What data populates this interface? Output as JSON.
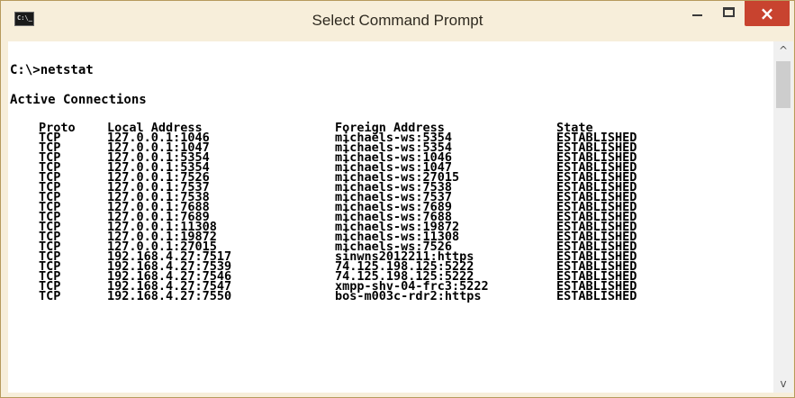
{
  "window": {
    "title": "Select Command Prompt",
    "icon_label": "C:\\_",
    "close_label": "×"
  },
  "console": {
    "prompt_line": "C:\\>netstat",
    "heading": "Active Connections",
    "columns": [
      "Proto",
      "Local Address",
      "Foreign Address",
      "State"
    ],
    "rows": [
      [
        "TCP",
        "127.0.0.1:1046",
        "michaels-ws:5354",
        "ESTABLISHED"
      ],
      [
        "TCP",
        "127.0.0.1:1047",
        "michaels-ws:5354",
        "ESTABLISHED"
      ],
      [
        "TCP",
        "127.0.0.1:5354",
        "michaels-ws:1046",
        "ESTABLISHED"
      ],
      [
        "TCP",
        "127.0.0.1:5354",
        "michaels-ws:1047",
        "ESTABLISHED"
      ],
      [
        "TCP",
        "127.0.0.1:7526",
        "michaels-ws:27015",
        "ESTABLISHED"
      ],
      [
        "TCP",
        "127.0.0.1:7537",
        "michaels-ws:7538",
        "ESTABLISHED"
      ],
      [
        "TCP",
        "127.0.0.1:7538",
        "michaels-ws:7537",
        "ESTABLISHED"
      ],
      [
        "TCP",
        "127.0.0.1:7688",
        "michaels-ws:7689",
        "ESTABLISHED"
      ],
      [
        "TCP",
        "127.0.0.1:7689",
        "michaels-ws:7688",
        "ESTABLISHED"
      ],
      [
        "TCP",
        "127.0.0.1:11308",
        "michaels-ws:19872",
        "ESTABLISHED"
      ],
      [
        "TCP",
        "127.0.0.1:19872",
        "michaels-ws:11308",
        "ESTABLISHED"
      ],
      [
        "TCP",
        "127.0.0.1:27015",
        "michaels-ws:7526",
        "ESTABLISHED"
      ],
      [
        "TCP",
        "192.168.4.27:7517",
        "sinwns2012211:https",
        "ESTABLISHED"
      ],
      [
        "TCP",
        "192.168.4.27:7539",
        "74.125.198.125:5222",
        "ESTABLISHED"
      ],
      [
        "TCP",
        "192.168.4.27:7546",
        "74.125.198.125:5222",
        "ESTABLISHED"
      ],
      [
        "TCP",
        "192.168.4.27:7547",
        "xmpp-shv-04-frc3:5222",
        "ESTABLISHED"
      ],
      [
        "TCP",
        "192.168.4.27:7550",
        "bos-m003c-rdr2:https",
        "ESTABLISHED"
      ]
    ]
  },
  "scrollbar": {
    "up_glyph": "^",
    "down_glyph": "v"
  },
  "colors": {
    "frame": "#f7eeda",
    "close_button": "#c8432f",
    "console_background": "#ffffff",
    "console_text": "#000000"
  }
}
